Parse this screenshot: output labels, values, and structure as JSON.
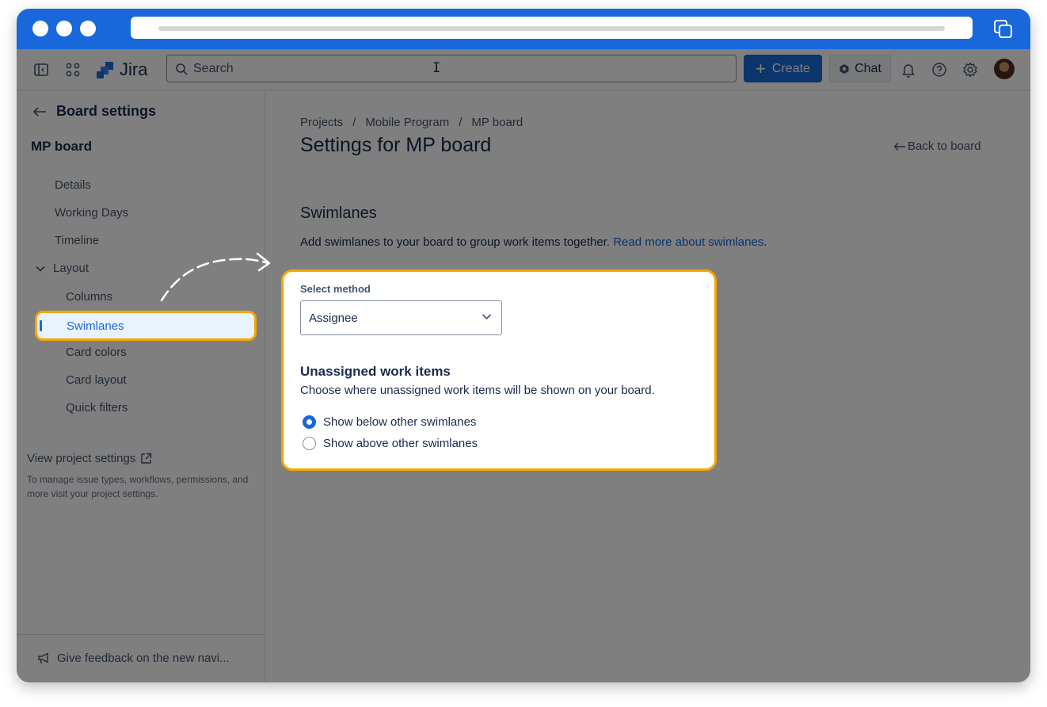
{
  "app": {
    "name": "Jira"
  },
  "topnav": {
    "search_placeholder": "Search",
    "cursor_glyph": "I",
    "create_label": "Create",
    "chat_label": "Chat"
  },
  "sidebar": {
    "back_label": "Board settings",
    "board_name": "MP board",
    "items": [
      {
        "label": "Details"
      },
      {
        "label": "Working Days"
      },
      {
        "label": "Timeline"
      }
    ],
    "layout_label": "Layout",
    "layout_items": [
      {
        "label": "Columns"
      },
      {
        "label": "Swimlanes",
        "active": true
      },
      {
        "label": "Card colors"
      },
      {
        "label": "Card layout"
      },
      {
        "label": "Quick filters"
      }
    ],
    "project_settings_label": "View project settings",
    "project_settings_desc": "To manage issue types, workflows, permissions, and more visit your project settings.",
    "feedback_label": "Give feedback on the new navi..."
  },
  "main": {
    "breadcrumbs": [
      "Projects",
      "Mobile Program",
      "MP board"
    ],
    "breadcrumb_sep": "/",
    "title": "Settings for MP board",
    "back_to_board": "Back to board",
    "section_title": "Swimlanes",
    "section_desc": "Add swimlanes to your board to group work items together. ",
    "section_link": "Read more about swimlanes",
    "section_desc_end": ".",
    "select_label": "Select method",
    "select_value": "Assignee",
    "unassigned_title": "Unassigned work items",
    "unassigned_desc": "Choose where unassigned work items will be shown on your board.",
    "radio_options": [
      {
        "label": "Show below other swimlanes",
        "checked": true
      },
      {
        "label": "Show above other swimlanes",
        "checked": false
      }
    ]
  },
  "colors": {
    "brand": "#1868db",
    "highlight": "#f5a700"
  }
}
